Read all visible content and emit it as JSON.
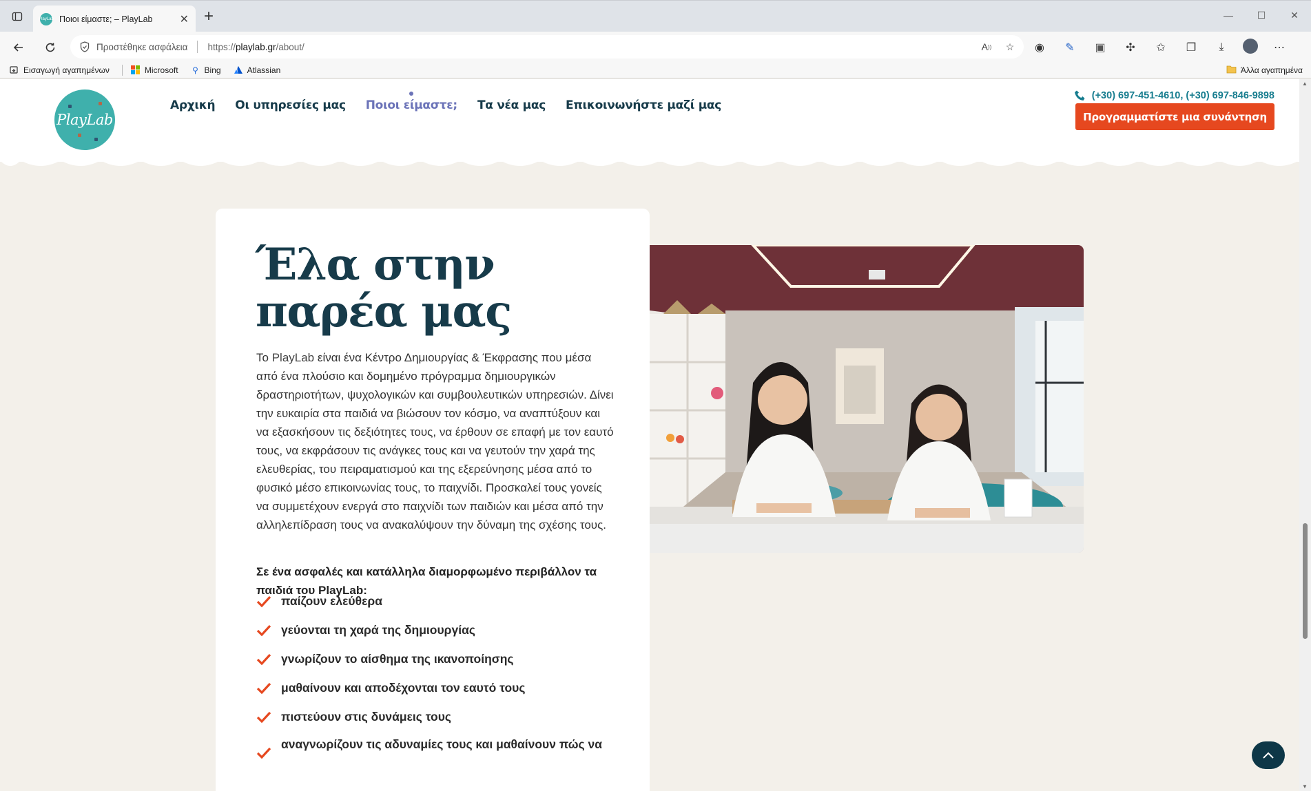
{
  "browser": {
    "tab_title": "Ποιοι είμαστε; – PlayLab",
    "tab_favicon_text": "PlayLab",
    "security_text": "Προστέθηκε ασφάλεια",
    "url_prefix": "https://",
    "url_host": "playlab.gr",
    "url_path": "/about/",
    "bookmarks": [
      {
        "label": "Εισαγωγή αγαπημένων",
        "icon": "import-icon"
      },
      {
        "label": "Microsoft",
        "icon": "microsoft-icon"
      },
      {
        "label": "Bing",
        "icon": "bing-icon"
      },
      {
        "label": "Atlassian",
        "icon": "atlassian-icon"
      }
    ],
    "other_bookmarks": "Άλλα αγαπημένα"
  },
  "site": {
    "logo_text": "PlayLab",
    "nav": [
      {
        "label": "Αρχική",
        "active": false
      },
      {
        "label": "Οι υπηρεσίες μας",
        "active": false
      },
      {
        "label": "Ποιοι είμαστε;",
        "active": true
      },
      {
        "label": "Τα νέα μας",
        "active": false
      },
      {
        "label": "Επικοινωνήστε μαζί μας",
        "active": false
      }
    ],
    "phone": "(+30) 697-451-4610, (+30) 697-846-9898",
    "cta_label": "Προγραμματίστε μια συνάντηση"
  },
  "content": {
    "headline": "Έλα στην παρέα μας",
    "intro_start": "Το ",
    "intro_brand": "PlayLab",
    "intro_rest": " είναι ένα Κέντρο Δημιουργίας & Έκφρασης που μέσα από ένα πλούσιο και δομημένο πρόγραμμα δημιουργικών δραστηριοτήτων, ψυχολογικών και συμβουλευτικών υπηρεσιών. Δίνει την ευκαιρία στα παιδιά να βιώσουν τον κόσμο, να αναπτύξουν και να εξασκήσουν τις δεξιότητες τους, να έρθουν σε επαφή με τον εαυτό τους, να εκφράσουν τις ανάγκες τους και να γευτούν την χαρά της ελευθερίας, του πειραματισμού και της εξερεύνησης μέσα από το φυσικό μέσο επικοινωνίας τους, το παιχνίδι. Προσκαλεί τους γονείς να συμμετέχουν ενεργά στο παιχνίδι των παιδιών και μέσα από την αλληλεπίδραση τους να ανακαλύψουν την δύναμη της σχέσης τους.",
    "lead": "Σε ένα ασφαλές και κατάλληλα διαμορφωμένο περιβάλλον τα παιδιά του PlayLab:",
    "checklist": [
      "παίζουν ελεύθερα",
      "γεύονται τη χαρά της δημιουργίας",
      "γνωρίζουν το αίσθημα της ικανοποίησης",
      "μαθαίνουν και αποδέχονται τον εαυτό τους",
      "πιστεύουν στις δυνάμεις τους",
      "αναγνωρίζουν τις αδυναμίες τους και μαθαίνουν πώς να"
    ]
  },
  "colors": {
    "accent": "#e6481f",
    "brand_teal": "#3fb0ac",
    "nav_text": "#173b4a",
    "nav_active": "#6b73b8",
    "page_bg": "#f3f0ea"
  }
}
